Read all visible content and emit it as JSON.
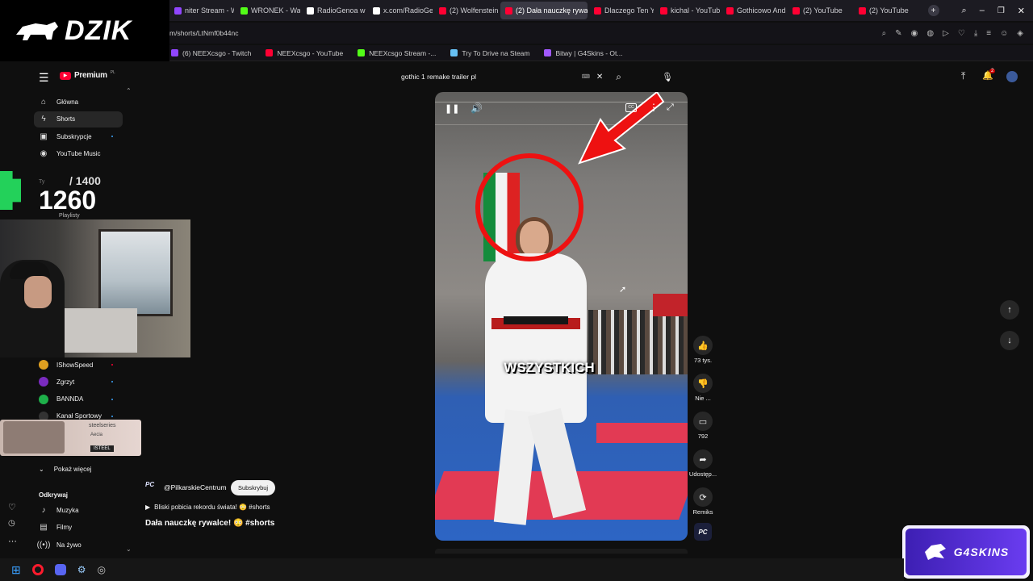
{
  "overlay": {
    "brand": "DZIK",
    "counter_total": "/ 1400",
    "counter_value": "1260",
    "counter_prefix": "Ty",
    "sponsor": "G4SKINS",
    "steelseries": "steelseries",
    "steel_badge": "ISTEEL",
    "steel_small": "Aecia"
  },
  "tabs": [
    {
      "label": "niter Stream - W",
      "color": "#9146ff"
    },
    {
      "label": "WRONEK - Watc",
      "color": "#53fc18"
    },
    {
      "label": "RadioGenoa w sz",
      "color": "#ffffff"
    },
    {
      "label": "x.com/RadioGen",
      "color": "#ffffff"
    },
    {
      "label": "(2) Wolfenstein I",
      "color": "#ff0033"
    },
    {
      "label": "(2) Dała nauczkę rywa",
      "color": "#ff0033",
      "active": true
    },
    {
      "label": "Dlaczego Ten Yo",
      "color": "#ff0033"
    },
    {
      "label": "kichal - YouTube",
      "color": "#ff0033"
    },
    {
      "label": "Gothicowo Andr",
      "color": "#ff0033"
    },
    {
      "label": "(2) YouTube",
      "color": "#ff0033"
    },
    {
      "label": "(2) YouTube",
      "color": "#ff0033"
    }
  ],
  "address": {
    "url": "m/shorts/LtNmf0b44nc"
  },
  "bookmarks": [
    {
      "label": "(6) NEEXcsgo - Twitch",
      "color": "#9146ff"
    },
    {
      "label": "NEEXcsgo - YouTube",
      "color": "#ff0033"
    },
    {
      "label": "NEEXcsgo Stream -...",
      "color": "#53fc18"
    },
    {
      "label": "Try To Drive na Steam",
      "color": "#66c0f4"
    },
    {
      "label": "Bitwy | G4Skins - Ot...",
      "color": "#a259ff"
    }
  ],
  "youtube": {
    "logo": "Premium",
    "logo_sup": "PL",
    "search_query": "gothic 1 remake trailer pl",
    "notif_count": "2"
  },
  "sidebar": {
    "main": [
      {
        "label": "Główna",
        "icon": "home-icon"
      },
      {
        "label": "Shorts",
        "icon": "shorts-icon",
        "selected": true
      },
      {
        "label": "Subskrypcje",
        "icon": "subscriptions-icon"
      },
      {
        "label": "YouTube Music",
        "icon": "music-icon"
      }
    ],
    "playlists_label": "Playlisty",
    "subs": [
      {
        "label": "IShowSpeed",
        "color": "#e0a020"
      },
      {
        "label": "Zgrzyt",
        "color": "#7a2bbf"
      },
      {
        "label": "BANNDA",
        "color": "#1eb04a"
      },
      {
        "label": "Kanał Sportowy",
        "color": "#333333"
      }
    ],
    "show_more": "Pokaż więcej",
    "explore_title": "Odkrywaj",
    "explore": [
      {
        "label": "Muzyka",
        "icon": "music-note-icon"
      },
      {
        "label": "Filmy",
        "icon": "film-icon"
      },
      {
        "label": "Na żywo",
        "icon": "live-icon"
      }
    ]
  },
  "video": {
    "caption": "WSZYSTKICH",
    "channel_badge": "PC"
  },
  "channel": {
    "handle": "@PilkarskieCentrum",
    "subscribe": "Subskrybuj",
    "badge": "PC",
    "music_line": "Bliski pobicia rekordu świata! 😳 #shorts",
    "title": "Dała nauczkę rywalce! 😳 #shorts"
  },
  "actions": [
    {
      "icon": "like-icon",
      "label": "73 tys."
    },
    {
      "icon": "dislike-icon",
      "label": "Nie ..."
    },
    {
      "icon": "comment-icon",
      "label": "792"
    },
    {
      "icon": "share-icon",
      "label": "Udostęp..."
    },
    {
      "icon": "remix-icon",
      "label": "Remiks"
    }
  ],
  "colors": {
    "accent": "#ff0033",
    "bg": "#0f0f0f",
    "counter_green": "#23d15a"
  }
}
